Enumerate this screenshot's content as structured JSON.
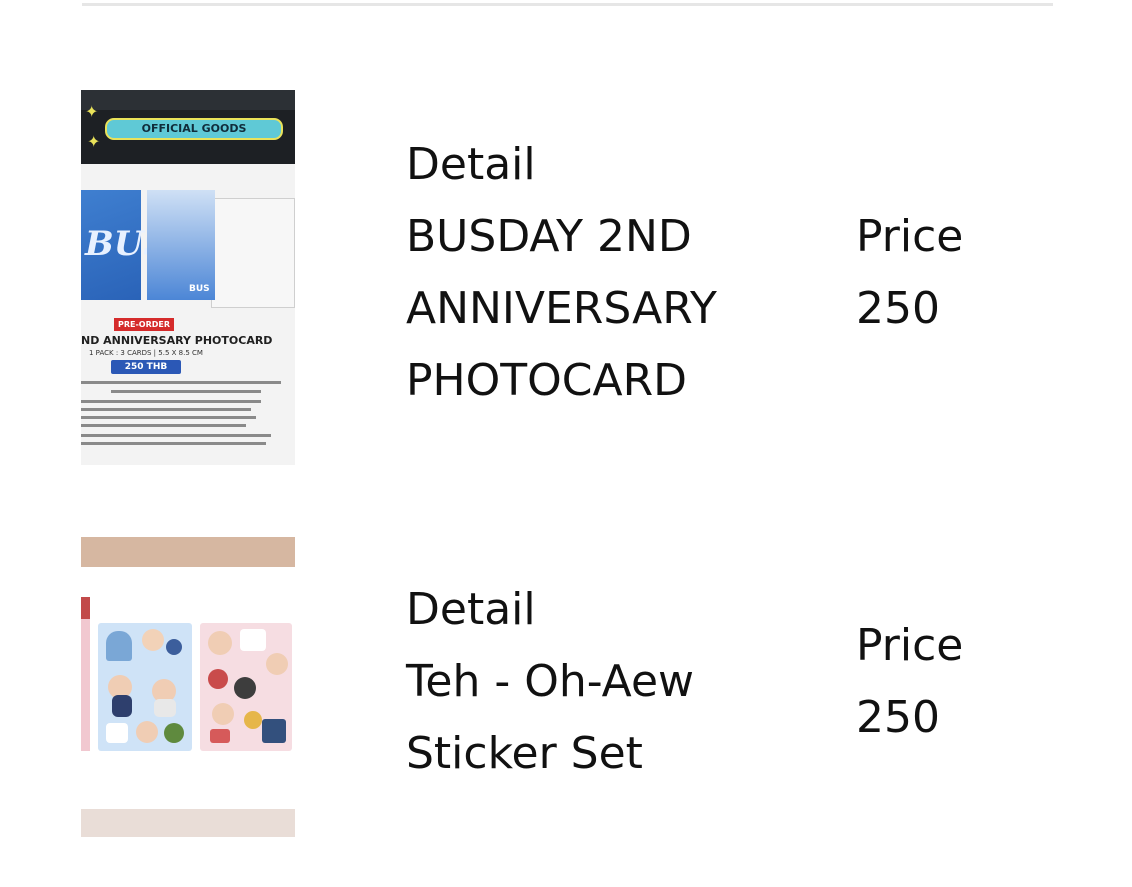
{
  "items": [
    {
      "image": {
        "badge": "OFFICIAL GOODS",
        "card_text": "BUS",
        "card_logo": "BUS",
        "preorder": "PRE-ORDER",
        "title": "ND ANNIVERSARY PHOTOCARD",
        "subtitle": "1 PACK : 3 CARDS  |  5.5 X 8.5 CM",
        "price_pill": "250 THB"
      },
      "detail_label": "Detail",
      "name_lines": [
        "BUSDAY 2ND",
        "ANNIVERSARY",
        "PHOTOCARD"
      ],
      "price_label": "Price",
      "price_value": "250"
    },
    {
      "detail_label": "Detail",
      "name_lines": [
        "Teh - Oh-Aew",
        "Sticker Set"
      ],
      "price_label": "Price",
      "price_value": "250"
    }
  ],
  "colors": {
    "text": "#111111",
    "divider": "#e6e6e6",
    "background": "#ffffff"
  }
}
